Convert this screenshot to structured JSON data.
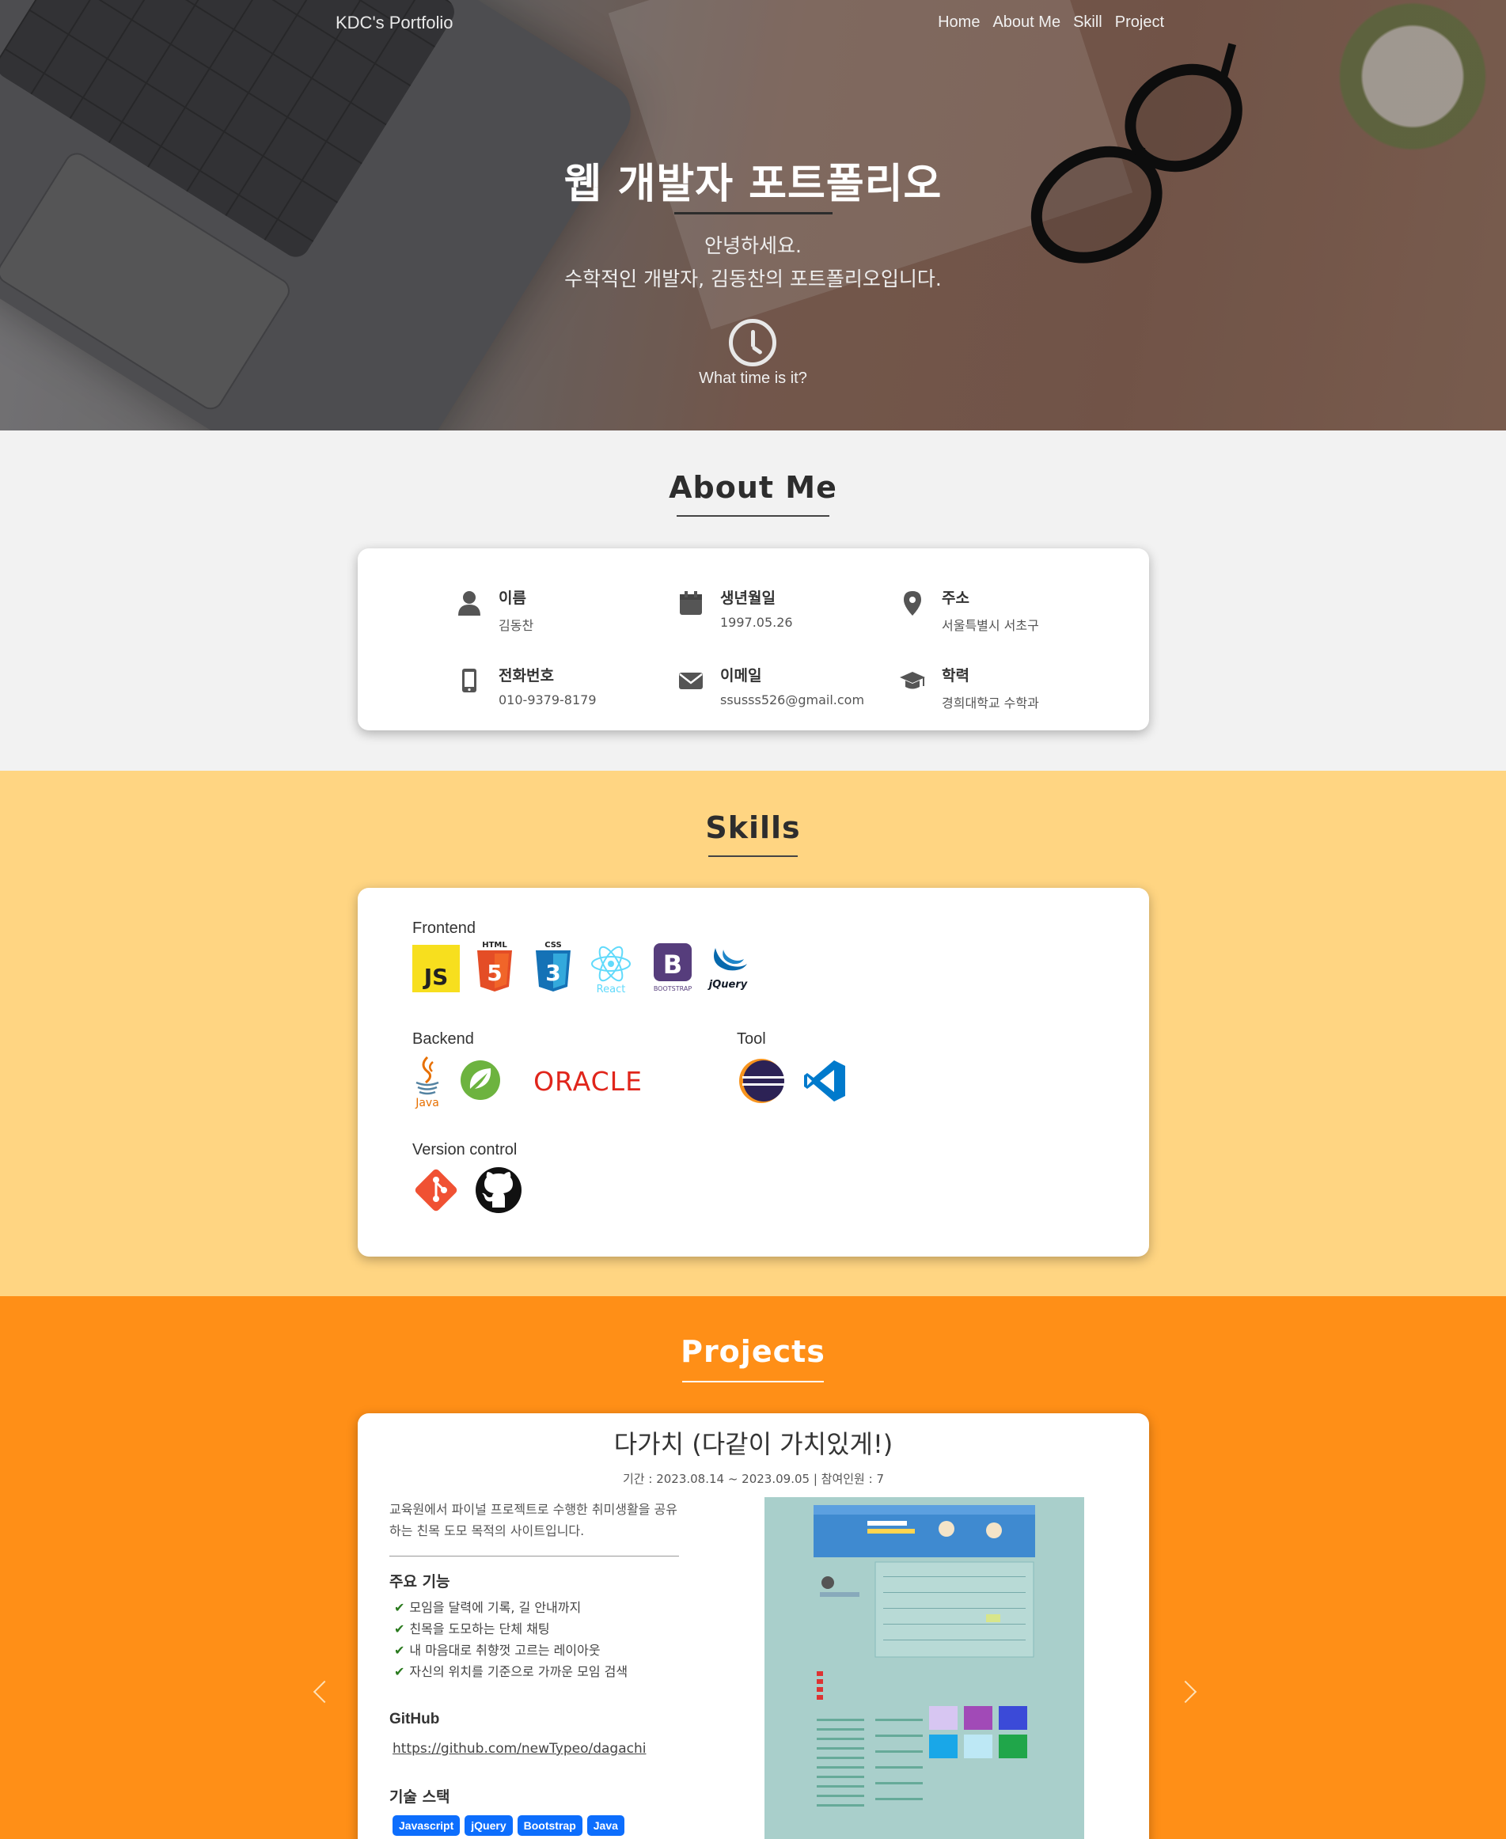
{
  "nav": {
    "brand": "KDC's Portfolio",
    "links": [
      "Home",
      "About Me",
      "Skill",
      "Project"
    ]
  },
  "hero": {
    "title": "웹 개발자 포트폴리오",
    "greeting": "안녕하세요.",
    "intro": "수학적인 개발자, 김동찬의 포트폴리오입니다.",
    "clock_label": "What time is it?"
  },
  "about": {
    "title": "About Me",
    "items": [
      {
        "label": "이름",
        "value": "김동찬",
        "icon": "person-icon"
      },
      {
        "label": "생년월일",
        "value": "1997.05.26",
        "icon": "calendar-icon"
      },
      {
        "label": "주소",
        "value": "서울특별시 서초구",
        "icon": "map-pin-icon"
      },
      {
        "label": "전화번호",
        "value": "010-9379-8179",
        "icon": "mobile-phone-icon"
      },
      {
        "label": "이메일",
        "value": "ssusss526@gmail.com",
        "icon": "envelope-icon"
      },
      {
        "label": "학력",
        "value": "경희대학교 수학과",
        "icon": "graduation-cap-icon"
      }
    ]
  },
  "skills": {
    "title": "Skills",
    "frontend": {
      "label": "Frontend",
      "react": "React",
      "bootstrap": "BOOTSTRAP",
      "jquery": "jQuery",
      "html": "HTML",
      "css": "CSS",
      "js": "JS"
    },
    "backend": {
      "label": "Backend",
      "java": "Java",
      "oracle": "ORACLE"
    },
    "tool": {
      "label": "Tool"
    },
    "version": {
      "label": "Version control"
    }
  },
  "projects": {
    "title": "Projects",
    "item": {
      "title": "다가치 (다같이 가치있게!)",
      "meta": "기간 : 2023.08.14 ~ 2023.09.05 | 참여인원 : 7",
      "desc": "교육원에서 파이널 프로젝트로 수행한 취미생활을 공유하는 친목 도모 목적의 사이트입니다.",
      "features_title": "주요 기능",
      "features": [
        "모임을 달력에 기록, 길 안내까지",
        "친목을 도모하는 단체 채팅",
        "내 마음대로 취향껏 고르는 레이아웃",
        "자신의 위치를 기준으로 가까운 모임 검색"
      ],
      "github_title": "GitHub",
      "github_url": "https://github.com/newTypeo/dagachi",
      "stack_title": "기술 스택",
      "stack": [
        "Javascript",
        "jQuery",
        "Bootstrap",
        "Java"
      ]
    }
  },
  "colors": {
    "about_bg": "#f2f2f2",
    "skills_bg": "#ffd582",
    "projects_bg": "#ff8f17",
    "tag": "#0d6efd"
  }
}
